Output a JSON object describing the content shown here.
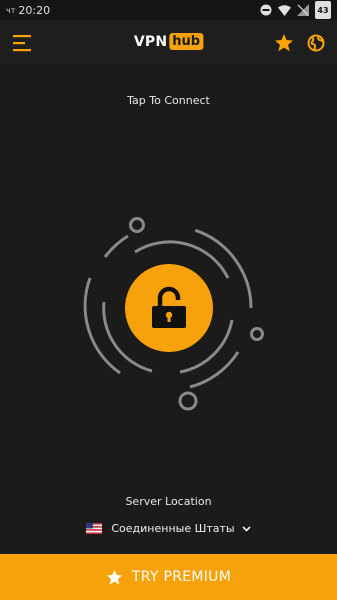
{
  "status_bar": {
    "day": "чт",
    "time": "20:20",
    "battery": "43"
  },
  "header": {
    "logo_vpn": "VPN",
    "logo_hub": "hub"
  },
  "main": {
    "connect_prompt": "Tap To Connect",
    "server_location_label": "Server Location",
    "server_location_value": "Соединенные Штаты"
  },
  "footer": {
    "premium_label": "TRY PREMIUM"
  },
  "colors": {
    "accent": "#f7a20a",
    "background": "#1b1b1b",
    "ring": "#8a8a8a"
  },
  "icons": [
    "menu-icon",
    "star-icon",
    "globe-icon",
    "unlocked-lock-icon",
    "us-flag-icon",
    "chevron-down-icon"
  ]
}
